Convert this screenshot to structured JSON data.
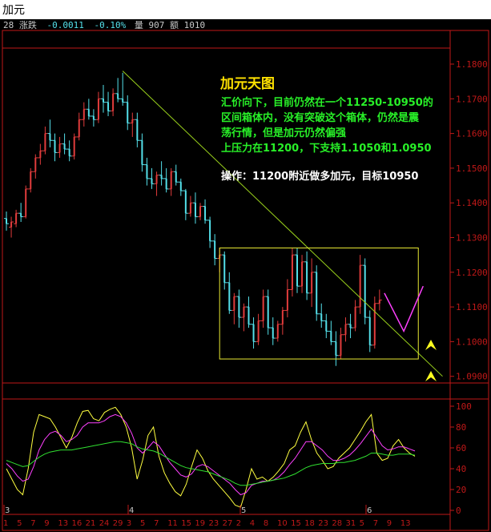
{
  "window": {
    "title": "加元"
  },
  "status_line": {
    "prefix": "28",
    "change_label": "涨跌",
    "change": "-0.0011",
    "pct": "-0.10%",
    "volume_label": "量",
    "volume": "907",
    "amount_label": "额",
    "amount": "1010"
  },
  "colors": {
    "up": "#e23c3c",
    "down": "#54e0ea",
    "frame": "#c01818",
    "trendline": "#9ad11c",
    "box": "#e8e832",
    "annotation_title": "#ffe100",
    "annotation_text": "#28f028",
    "annotation_op": "#ffffff",
    "k_line": "#ffff40",
    "d_line": "#ff40ff",
    "j_line": "#30e030",
    "projection": "#ff40ff",
    "arrow": "#ffff20"
  },
  "annotation": {
    "title": "加元天图",
    "lines": [
      "汇价向下，目前仍然在一个11250-10950的",
      "区间箱体内，没有突破这个箱体，仍然是震",
      "荡行情，但是加元仍然偏强",
      "上压力在11200，下支持1.1050和1.0950"
    ],
    "operation": "操作：11200附近做多加元，目标10950"
  },
  "chart_data": [
    {
      "type": "candlestick",
      "y_ticks": [
        "1.1800",
        "1.1700",
        "1.1600",
        "1.1500",
        "1.1400",
        "1.1300",
        "1.1200",
        "1.1100",
        "1.1000",
        "1.0900"
      ],
      "ylim": [
        1.089,
        1.1835
      ],
      "grid": false,
      "month_labels": [
        "3",
        "4",
        "5",
        "6"
      ],
      "date_labels": [
        "1",
        "5",
        "7",
        "9",
        "13",
        "16",
        "21",
        "24",
        "29",
        "3",
        "5",
        "7",
        "11",
        "15",
        "19",
        "23",
        "27",
        "2",
        "4",
        "8",
        "10",
        "15",
        "18",
        "23",
        "28",
        "31",
        "5",
        "7",
        "9",
        "13"
      ],
      "candles_ohlc": [
        [
          1.1355,
          1.1375,
          1.132,
          1.134
        ],
        [
          1.133,
          1.136,
          1.13,
          1.1345
        ],
        [
          1.134,
          1.138,
          1.133,
          1.137
        ],
        [
          1.137,
          1.14,
          1.1345,
          1.136
        ],
        [
          1.136,
          1.145,
          1.1355,
          1.144
        ],
        [
          1.144,
          1.15,
          1.143,
          1.149
        ],
        [
          1.149,
          1.154,
          1.147,
          1.153
        ],
        [
          1.153,
          1.157,
          1.151,
          1.155
        ],
        [
          1.155,
          1.162,
          1.154,
          1.16
        ],
        [
          1.16,
          1.164,
          1.156,
          1.158
        ],
        [
          1.158,
          1.16,
          1.152,
          1.1545
        ],
        [
          1.1545,
          1.159,
          1.153,
          1.157
        ],
        [
          1.157,
          1.16,
          1.154,
          1.1555
        ],
        [
          1.1555,
          1.158,
          1.152,
          1.1535
        ],
        [
          1.1535,
          1.16,
          1.1525,
          1.159
        ],
        [
          1.159,
          1.166,
          1.158,
          1.164
        ],
        [
          1.164,
          1.169,
          1.162,
          1.167
        ],
        [
          1.167,
          1.17,
          1.164,
          1.165
        ],
        [
          1.165,
          1.167,
          1.162,
          1.164
        ],
        [
          1.164,
          1.172,
          1.163,
          1.17
        ],
        [
          1.17,
          1.174,
          1.166,
          1.169
        ],
        [
          1.169,
          1.172,
          1.165,
          1.1665
        ],
        [
          1.1665,
          1.173,
          1.165,
          1.1715
        ],
        [
          1.1715,
          1.176,
          1.169,
          1.17
        ],
        [
          1.17,
          1.1775,
          1.168,
          1.169
        ],
        [
          1.169,
          1.171,
          1.161,
          1.163
        ],
        [
          1.163,
          1.166,
          1.159,
          1.164
        ],
        [
          1.164,
          1.166,
          1.156,
          1.158
        ],
        [
          1.158,
          1.16,
          1.149,
          1.151
        ],
        [
          1.151,
          1.153,
          1.145,
          1.147
        ],
        [
          1.147,
          1.15,
          1.144,
          1.1455
        ],
        [
          1.1455,
          1.149,
          1.142,
          1.148
        ],
        [
          1.148,
          1.152,
          1.145,
          1.147
        ],
        [
          1.147,
          1.15,
          1.143,
          1.144
        ],
        [
          1.144,
          1.15,
          1.142,
          1.149
        ],
        [
          1.149,
          1.151,
          1.145,
          1.146
        ],
        [
          1.146,
          1.147,
          1.142,
          1.1435
        ],
        [
          1.1435,
          1.144,
          1.135,
          1.137
        ],
        [
          1.137,
          1.142,
          1.136,
          1.14
        ],
        [
          1.14,
          1.143,
          1.134,
          1.136
        ],
        [
          1.136,
          1.14,
          1.135,
          1.139
        ],
        [
          1.139,
          1.141,
          1.134,
          1.135
        ],
        [
          1.135,
          1.136,
          1.127,
          1.129
        ],
        [
          1.129,
          1.131,
          1.122,
          1.124
        ],
        [
          1.124,
          1.127,
          1.12,
          1.125
        ],
        [
          1.125,
          1.126,
          1.115,
          1.117
        ],
        [
          1.117,
          1.12,
          1.108,
          1.109
        ],
        [
          1.109,
          1.114,
          1.105,
          1.113
        ],
        [
          1.113,
          1.115,
          1.104,
          1.107
        ],
        [
          1.107,
          1.111,
          1.103,
          1.11
        ],
        [
          1.11,
          1.113,
          1.104,
          1.105
        ],
        [
          1.105,
          1.107,
          1.098,
          1.1
        ],
        [
          1.1,
          1.108,
          1.099,
          1.106
        ],
        [
          1.106,
          1.115,
          1.104,
          1.113
        ],
        [
          1.113,
          1.115,
          1.102,
          1.104
        ],
        [
          1.104,
          1.107,
          1.099,
          1.101
        ],
        [
          1.101,
          1.106,
          1.1,
          1.105
        ],
        [
          1.105,
          1.11,
          1.102,
          1.109
        ],
        [
          1.109,
          1.118,
          1.107,
          1.115
        ],
        [
          1.115,
          1.127,
          1.113,
          1.125
        ],
        [
          1.125,
          1.127,
          1.114,
          1.116
        ],
        [
          1.116,
          1.125,
          1.114,
          1.123
        ],
        [
          1.123,
          1.126,
          1.112,
          1.114
        ],
        [
          1.114,
          1.124,
          1.11,
          1.12
        ],
        [
          1.12,
          1.122,
          1.106,
          1.108
        ],
        [
          1.108,
          1.111,
          1.104,
          1.106
        ],
        [
          1.106,
          1.108,
          1.101,
          1.103
        ],
        [
          1.103,
          1.106,
          1.099,
          1.1
        ],
        [
          1.1,
          1.103,
          1.093,
          1.096
        ],
        [
          1.096,
          1.104,
          1.095,
          1.102
        ],
        [
          1.102,
          1.107,
          1.1,
          1.105
        ],
        [
          1.105,
          1.108,
          1.101,
          1.104
        ],
        [
          1.104,
          1.112,
          1.103,
          1.11
        ],
        [
          1.11,
          1.125,
          1.108,
          1.122
        ],
        [
          1.122,
          1.124,
          1.105,
          1.107
        ],
        [
          1.107,
          1.109,
          1.097,
          1.099
        ],
        [
          1.099,
          1.113,
          1.098,
          1.111
        ],
        [
          1.111,
          1.115,
          1.109,
          1.112
        ]
      ],
      "trendline": {
        "from": {
          "bar_index": 24,
          "price": 1.178
        },
        "to": {
          "bar_index": 90,
          "price": 1.09
        }
      },
      "box": {
        "upper": 1.127,
        "lower": 1.095,
        "from_bar_index": 44,
        "to_bar_index": 85
      },
      "projection_path": [
        [
          78,
          1.114
        ],
        [
          82,
          1.103
        ],
        [
          86,
          1.116
        ]
      ]
    },
    {
      "type": "line",
      "y_ticks": [
        "100",
        "80",
        "60",
        "40",
        "20",
        "0"
      ],
      "ylim": [
        0,
        100
      ],
      "grid": false,
      "series": [
        {
          "key": "k",
          "values": [
            40,
            30,
            20,
            15,
            40,
            75,
            92,
            90,
            88,
            80,
            70,
            60,
            70,
            84,
            95,
            96,
            88,
            86,
            94,
            97,
            99,
            92,
            80,
            60,
            30,
            48,
            72,
            80,
            52,
            36,
            26,
            18,
            14,
            25,
            42,
            58,
            50,
            38,
            30,
            24,
            18,
            12,
            5,
            3,
            20,
            40,
            30,
            32,
            28,
            32,
            38,
            45,
            58,
            62,
            75,
            85,
            68,
            55,
            48,
            40,
            42,
            50,
            55,
            60,
            68,
            76,
            85,
            92,
            55,
            48,
            50,
            62,
            68,
            60,
            55,
            52
          ]
        },
        {
          "key": "d",
          "values": [
            45,
            40,
            33,
            28,
            30,
            42,
            58,
            68,
            74,
            76,
            72,
            66,
            68,
            72,
            80,
            84,
            84,
            84,
            86,
            90,
            92,
            90,
            84,
            74,
            60,
            55,
            60,
            66,
            62,
            54,
            46,
            40,
            34,
            32,
            35,
            42,
            44,
            42,
            38,
            34,
            30,
            26,
            20,
            15,
            17,
            24,
            26,
            28,
            28,
            29,
            32,
            37,
            44,
            50,
            58,
            66,
            66,
            62,
            58,
            52,
            48,
            48,
            50,
            53,
            58,
            64,
            71,
            78,
            70,
            62,
            58,
            59,
            61,
            61,
            59,
            57
          ]
        },
        {
          "key": "j",
          "values": [
            48,
            46,
            44,
            42,
            43,
            47,
            51,
            54,
            56,
            57,
            58,
            58,
            58,
            59,
            60,
            61,
            62,
            63,
            64,
            65,
            66,
            66,
            65,
            64,
            61,
            59,
            58,
            57,
            55,
            52,
            49,
            46,
            43,
            41,
            40,
            39,
            38,
            37,
            35,
            33,
            31,
            29,
            26,
            24,
            24,
            25,
            26,
            27,
            28,
            29,
            30,
            31,
            33,
            35,
            38,
            41,
            43,
            44,
            45,
            45,
            45,
            46,
            46,
            47,
            48,
            50,
            52,
            55,
            55,
            54,
            53,
            53,
            54,
            54,
            54,
            53
          ]
        }
      ]
    }
  ]
}
